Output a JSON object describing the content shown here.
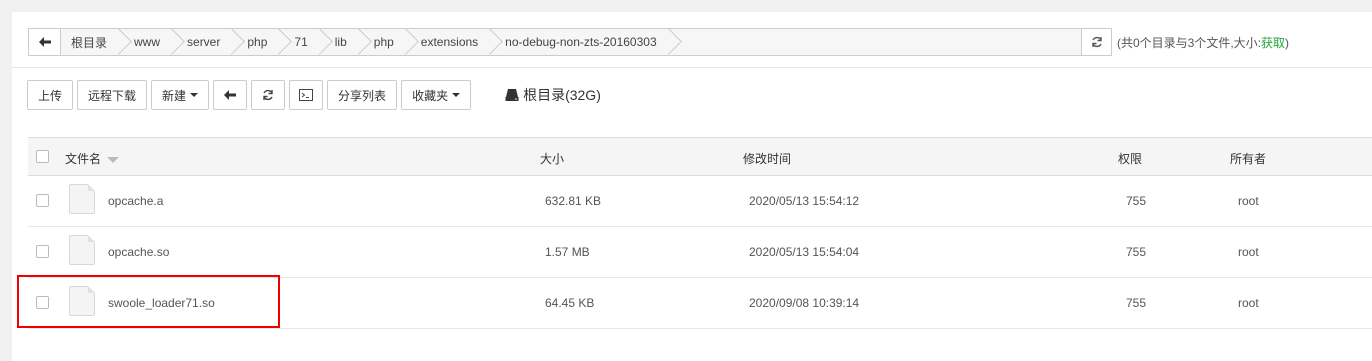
{
  "breadcrumb": [
    "根目录",
    "www",
    "server",
    "php",
    "71",
    "lib",
    "php",
    "extensions",
    "no-debug-non-zts-20160303"
  ],
  "summary": {
    "text": "(共0个目录与3个文件,大小:",
    "fetch": "获取",
    "close": ")"
  },
  "toolbar": {
    "upload": "上传",
    "remote_download": "远程下载",
    "new": "新建",
    "share_list": "分享列表",
    "favorites": "收藏夹",
    "disk": "根目录(32G)"
  },
  "table": {
    "headers": {
      "name": "文件名",
      "size": "大小",
      "modified": "修改时间",
      "perm": "权限",
      "owner": "所有者"
    },
    "rows": [
      {
        "name": "opcache.a",
        "size": "632.81 KB",
        "modified": "2020/05/13 15:54:12",
        "perm": "755",
        "owner": "root"
      },
      {
        "name": "opcache.so",
        "size": "1.57 MB",
        "modified": "2020/05/13 15:54:04",
        "perm": "755",
        "owner": "root"
      },
      {
        "name": "swoole_loader71.so",
        "size": "64.45 KB",
        "modified": "2020/09/08 10:39:14",
        "perm": "755",
        "owner": "root"
      }
    ]
  },
  "colors": {
    "accent": "#20a53a",
    "highlight": "#e00000"
  }
}
